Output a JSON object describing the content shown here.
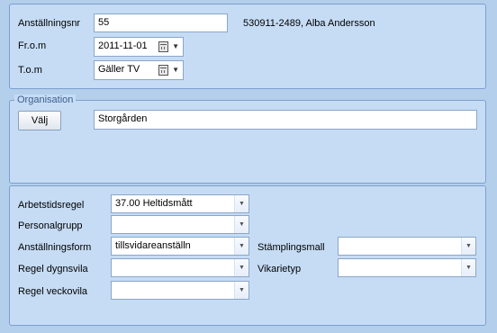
{
  "employment": {
    "number_label": "Anställningsnr",
    "number_value": "55",
    "person_info": "530911-2489, Alba Andersson",
    "from_label": "Fr.o.m",
    "from_value": "2011-11-01",
    "to_label": "T.o.m",
    "to_value": "Gäller TV"
  },
  "organisation": {
    "title": "Organisation",
    "select_button": "Välj",
    "value": "Storgården"
  },
  "rules": {
    "arbetstidsregel_label": "Arbetstidsregel",
    "arbetstidsregel_value": "37.00 Heltidsmått",
    "personalgrupp_label": "Personalgrupp",
    "personalgrupp_value": "",
    "anstallningsform_label": "Anställningsform",
    "anstallningsform_value": "tillsvidareanställn",
    "regel_dygnsvila_label": "Regel dygnsvila",
    "regel_dygnsvila_value": "",
    "regel_veckovila_label": "Regel veckovila",
    "regel_veckovila_value": "",
    "stamplingsmall_label": "Stämplingsmall",
    "stamplingsmall_value": "",
    "vikarietyp_label": "Vikarietyp",
    "vikarietyp_value": ""
  },
  "colors": {
    "background": "#b4cfeb",
    "panel": "#c6dcf5",
    "border": "#7a9fcf",
    "group_title": "#3a5f8c"
  }
}
